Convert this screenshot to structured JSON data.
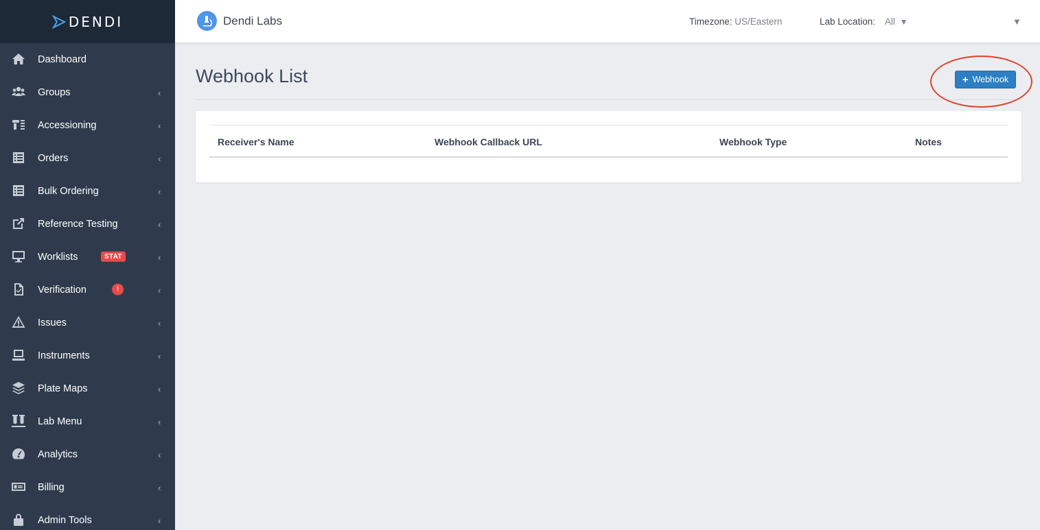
{
  "app": {
    "logo_text": "DENDI",
    "brand_name": "Dendi Labs"
  },
  "header": {
    "timezone_label": "Timezone:",
    "timezone_value": "US/Eastern",
    "lab_location_label": "Lab Location:",
    "lab_location_value": "All",
    "caret": "▼",
    "user_menu_caret": "▼"
  },
  "sidebar": {
    "chevron": "‹",
    "items": [
      {
        "label": "Dashboard",
        "icon": "home-icon"
      },
      {
        "label": "Groups",
        "icon": "users-icon"
      },
      {
        "label": "Accessioning",
        "icon": "accessioning-icon"
      },
      {
        "label": "Orders",
        "icon": "list-icon"
      },
      {
        "label": "Bulk Ordering",
        "icon": "list-icon"
      },
      {
        "label": "Reference Testing",
        "icon": "external-link-icon"
      },
      {
        "label": "Worklists",
        "icon": "desktop-icon",
        "badge": "STAT"
      },
      {
        "label": "Verification",
        "icon": "file-check-icon",
        "badge": "!"
      },
      {
        "label": "Issues",
        "icon": "warning-icon"
      },
      {
        "label": "Instruments",
        "icon": "laptop-icon"
      },
      {
        "label": "Plate Maps",
        "icon": "layers-icon"
      },
      {
        "label": "Lab Menu",
        "icon": "test-tubes-icon"
      },
      {
        "label": "Analytics",
        "icon": "gauge-icon"
      },
      {
        "label": "Billing",
        "icon": "money-icon"
      },
      {
        "label": "Admin Tools",
        "icon": "lock-icon"
      }
    ]
  },
  "main": {
    "page_title": "Webhook List",
    "add_button_label": "Webhook",
    "add_button_icon": "+",
    "table": {
      "columns": [
        "Receiver's Name",
        "Webhook Callback URL",
        "Webhook Type",
        "Notes"
      ],
      "rows": []
    }
  },
  "colors": {
    "sidebar_bg": "#2f3b4c",
    "logo_bar_bg": "#1e2938",
    "primary_button": "#2b7fc2",
    "badge_red": "#e84b4b",
    "annotation_ring": "#e0412f"
  }
}
